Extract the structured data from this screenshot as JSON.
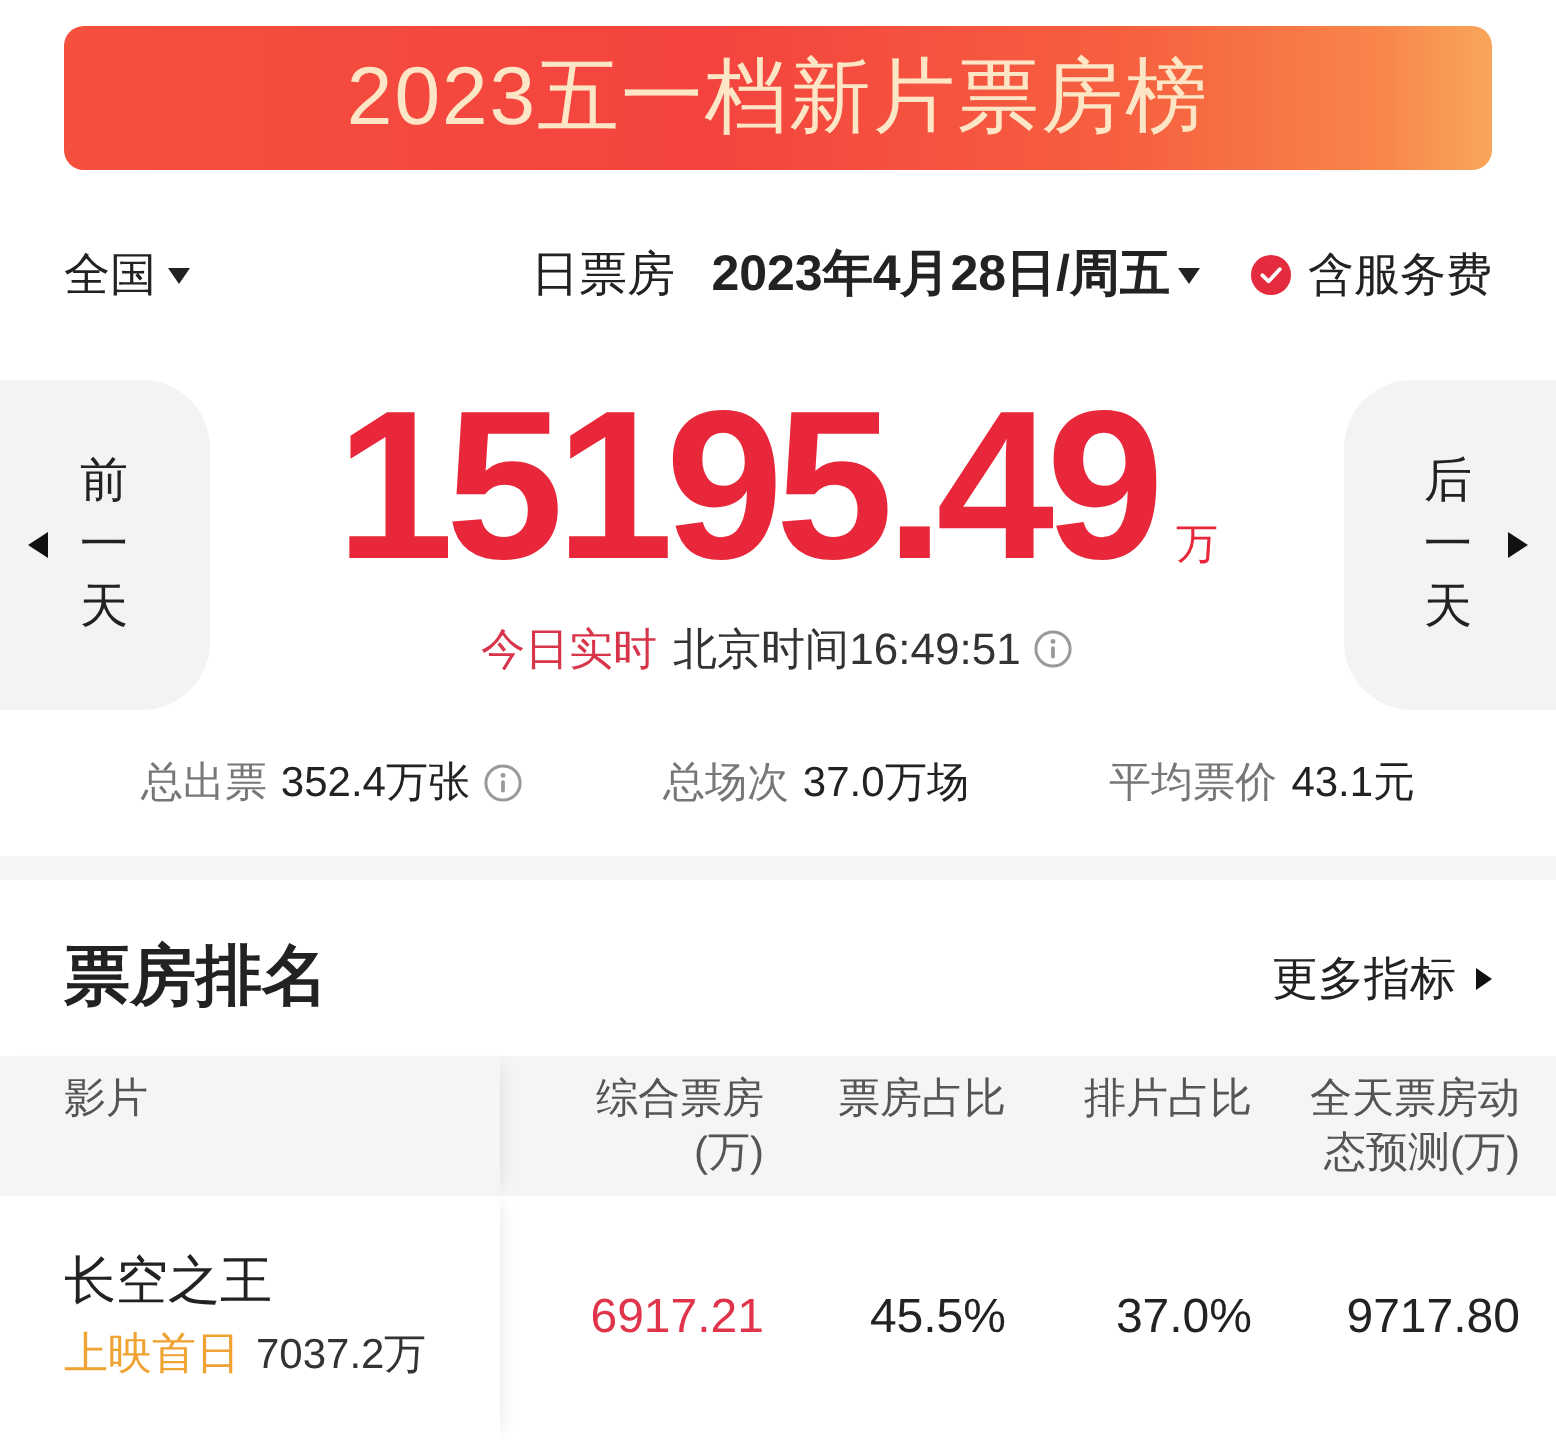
{
  "banner": {
    "title": "2023五一档新片票房榜"
  },
  "filter_bar": {
    "region": "全国",
    "metric": "日票房",
    "date": "2023年4月28日/周五",
    "service_fee": {
      "label": "含服务费",
      "checked": true
    }
  },
  "box_office": {
    "prev_day": "前一天",
    "next_day": "后一天",
    "total": "15195.49",
    "unit": "万",
    "live_label": "今日实时",
    "time": "北京时间16:49:51"
  },
  "stats": [
    {
      "label": "总出票",
      "value": "352.4万张",
      "info": true
    },
    {
      "label": "总场次",
      "value": "37.0万场",
      "info": false
    },
    {
      "label": "平均票价",
      "value": "43.1元",
      "info": false
    }
  ],
  "ranking": {
    "title": "票房排名",
    "more": "更多指标",
    "columns": [
      "影片",
      "综合票房(万)",
      "票房占比",
      "排片占比",
      "全天票房动态预测(万)"
    ],
    "rows": [
      {
        "film": {
          "title": "长空之王",
          "tag": "上映首日",
          "tag_value": "7037.2万"
        },
        "box_office": "6917.21",
        "box_office_share": "45.5%",
        "screening_share": "37.0%",
        "forecast": "9717.80"
      }
    ]
  }
}
